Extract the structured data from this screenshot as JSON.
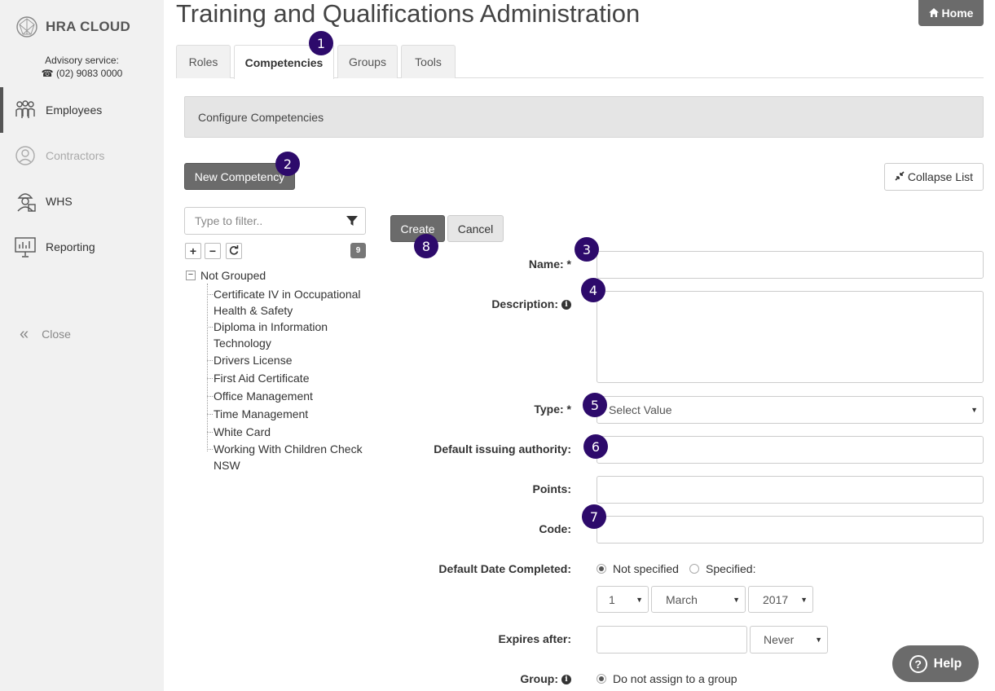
{
  "sidebar": {
    "logo_text": "HRA CLOUD",
    "advisory_label": "Advisory service:",
    "advisory_phone": "(02) 9083 0000",
    "items": [
      {
        "label": "Employees",
        "icon": "employees-icon",
        "state": "active"
      },
      {
        "label": "Contractors",
        "icon": "contractors-icon",
        "state": "disabled"
      },
      {
        "label": "WHS",
        "icon": "whs-icon",
        "state": "normal"
      },
      {
        "label": "Reporting",
        "icon": "reporting-icon",
        "state": "normal"
      }
    ],
    "close_label": "Close"
  },
  "header": {
    "title": "Training and Qualifications Administration",
    "home_label": "Home"
  },
  "tabs": [
    {
      "label": "Roles",
      "active": false
    },
    {
      "label": "Competencies",
      "active": true
    },
    {
      "label": "Groups",
      "active": false
    },
    {
      "label": "Tools",
      "active": false
    }
  ],
  "panel": {
    "header": "Configure Competencies",
    "new_button": "New Competency",
    "collapse_button": "Collapse List"
  },
  "filter": {
    "placeholder": "Type to filter..",
    "count": "9"
  },
  "tree": {
    "group": "Not Grouped",
    "items": [
      "Certificate IV in Occupational Health & Safety",
      "Diploma in Information Technology",
      "Drivers License",
      "First Aid Certificate",
      "Office Management",
      "Time Management",
      "White Card",
      "Working With Children Check NSW"
    ]
  },
  "form": {
    "create_label": "Create",
    "cancel_label": "Cancel",
    "name_label": "Name: *",
    "description_label": "Description:",
    "type_label": "Type: *",
    "type_value": "Select Value",
    "issuing_label": "Default issuing authority:",
    "points_label": "Points:",
    "code_label": "Code:",
    "date_label": "Default Date Completed:",
    "date_not_specified": "Not specified",
    "date_specified": "Specified:",
    "day_value": "1",
    "month_value": "March",
    "year_value": "2017",
    "expires_label": "Expires after:",
    "expires_unit": "Never",
    "group_label": "Group:",
    "group_option": "Do not assign to a group"
  },
  "callouts": [
    "1",
    "2",
    "3",
    "4",
    "5",
    "6",
    "7",
    "8"
  ],
  "help_label": "Help",
  "colors": {
    "sidebar_bg": "#f1f1f1",
    "button_dark": "#6b6b6b",
    "callout": "#2d0a6b"
  }
}
